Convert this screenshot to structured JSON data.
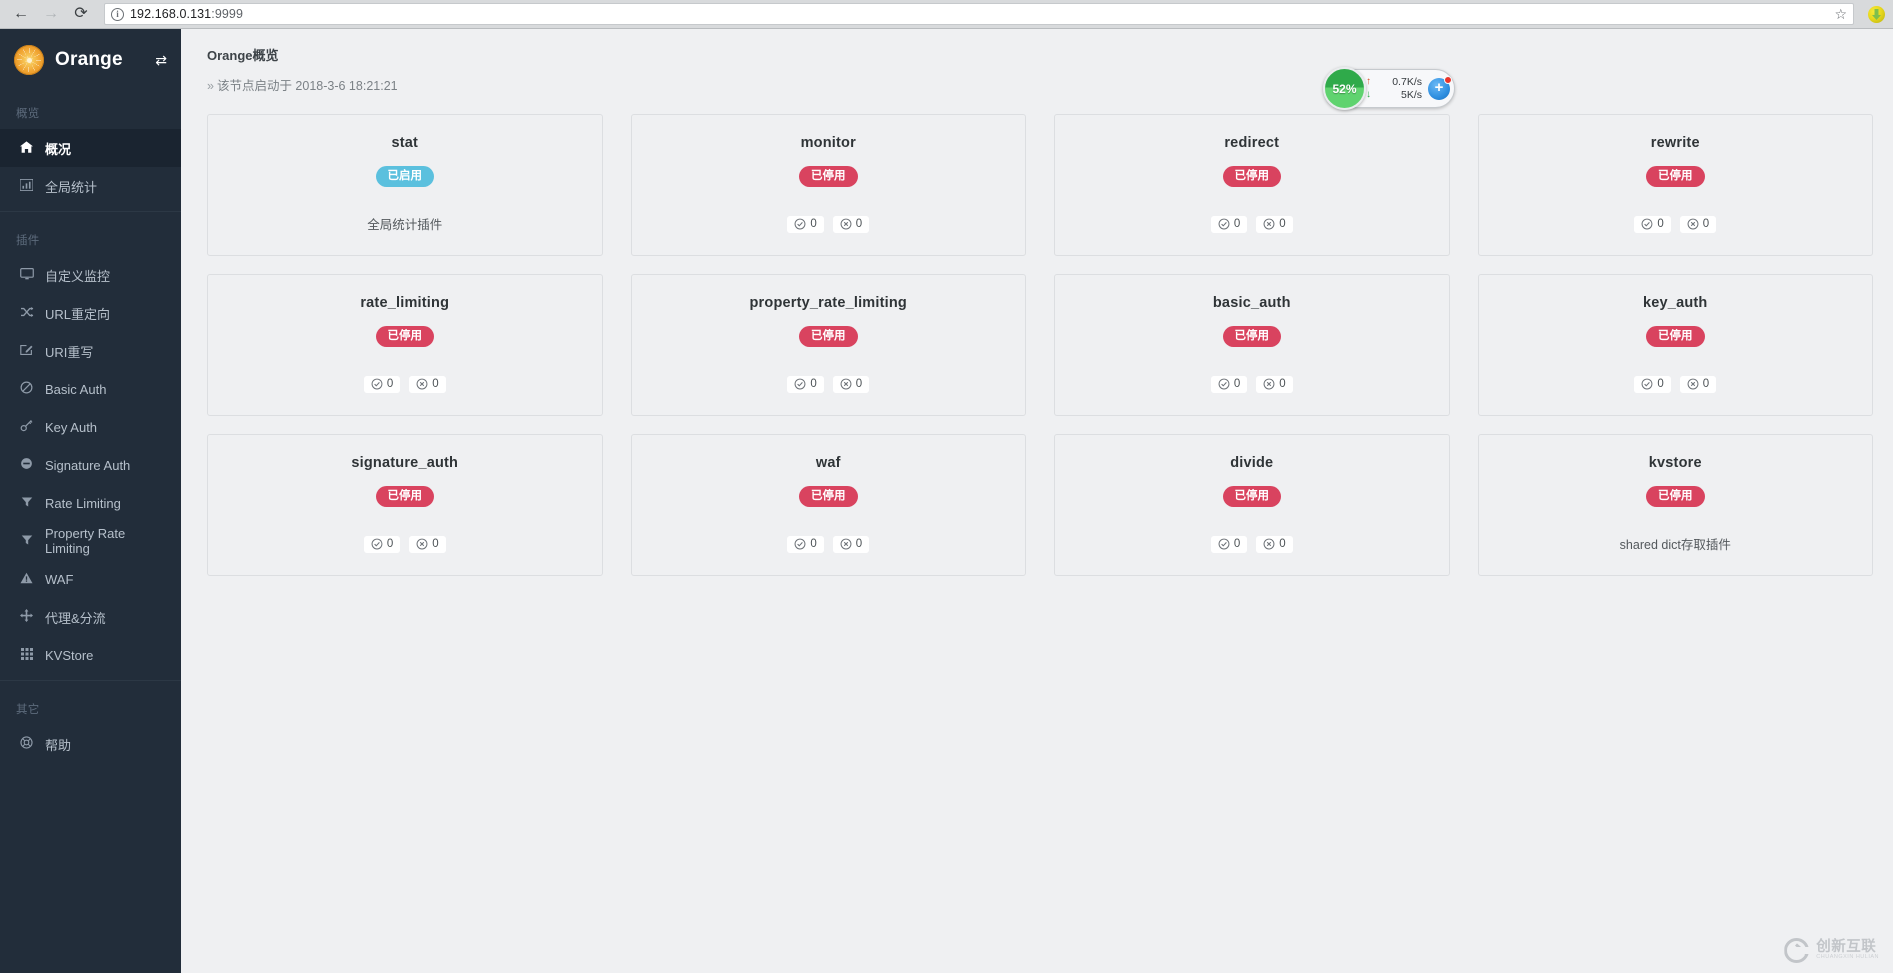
{
  "browser": {
    "back_icon": "←",
    "forward_icon": "→",
    "reload_icon": "⟳",
    "info_icon": "i",
    "url_host": "192.168.0.131",
    "url_port": ":9999",
    "star_icon": "☆",
    "extension_icon": "extension-icon"
  },
  "sidebar": {
    "brand": "Orange",
    "logo_icon": "orange-logo",
    "toggle_icon": "⇄",
    "sections": [
      {
        "label": "概览",
        "items": [
          {
            "label": "概况",
            "icon": "🏠",
            "active": true
          },
          {
            "label": "全局统计",
            "icon": "📊",
            "active": false
          }
        ]
      },
      {
        "label": "插件",
        "items": [
          {
            "label": "自定义监控",
            "icon": "🖥",
            "active": false
          },
          {
            "label": "URL重定向",
            "icon": "⤫",
            "active": false
          },
          {
            "label": "URI重写",
            "icon": "✎",
            "active": false
          },
          {
            "label": "Basic Auth",
            "icon": "⊘",
            "active": false
          },
          {
            "label": "Key Auth",
            "icon": "🔑",
            "active": false
          },
          {
            "label": "Signature Auth",
            "icon": "⊖",
            "active": false
          },
          {
            "label": "Rate Limiting",
            "icon": "▼",
            "active": false
          },
          {
            "label": "Property Rate Limiting",
            "icon": "▼",
            "active": false
          },
          {
            "label": "WAF",
            "icon": "⚠",
            "active": false
          },
          {
            "label": "代理&分流",
            "icon": "✥",
            "active": false
          },
          {
            "label": "KVStore",
            "icon": "▦",
            "active": false
          }
        ]
      },
      {
        "label": "其它",
        "items": [
          {
            "label": "帮助",
            "icon": "☉",
            "active": false
          }
        ]
      }
    ]
  },
  "page": {
    "title": "Orange概览",
    "subtitle_chevron": "»",
    "subtitle": "该节点启动于 2018-3-6 18:21:21"
  },
  "cards": [
    {
      "name": "stat",
      "status": "已启用",
      "status_kind": "on",
      "desc": "全局统计插件",
      "ok": null,
      "err": null
    },
    {
      "name": "monitor",
      "status": "已停用",
      "status_kind": "off",
      "desc": null,
      "ok": "0",
      "err": "0"
    },
    {
      "name": "redirect",
      "status": "已停用",
      "status_kind": "off",
      "desc": null,
      "ok": "0",
      "err": "0"
    },
    {
      "name": "rewrite",
      "status": "已停用",
      "status_kind": "off",
      "desc": null,
      "ok": "0",
      "err": "0"
    },
    {
      "name": "rate_limiting",
      "status": "已停用",
      "status_kind": "off",
      "desc": null,
      "ok": "0",
      "err": "0"
    },
    {
      "name": "property_rate_limiting",
      "status": "已停用",
      "status_kind": "off",
      "desc": null,
      "ok": "0",
      "err": "0"
    },
    {
      "name": "basic_auth",
      "status": "已停用",
      "status_kind": "off",
      "desc": null,
      "ok": "0",
      "err": "0"
    },
    {
      "name": "key_auth",
      "status": "已停用",
      "status_kind": "off",
      "desc": null,
      "ok": "0",
      "err": "0"
    },
    {
      "name": "signature_auth",
      "status": "已停用",
      "status_kind": "off",
      "desc": null,
      "ok": "0",
      "err": "0"
    },
    {
      "name": "waf",
      "status": "已停用",
      "status_kind": "off",
      "desc": null,
      "ok": "0",
      "err": "0"
    },
    {
      "name": "divide",
      "status": "已停用",
      "status_kind": "off",
      "desc": null,
      "ok": "0",
      "err": "0"
    },
    {
      "name": "kvstore",
      "status": "已停用",
      "status_kind": "off",
      "desc": "shared dict存取插件",
      "ok": null,
      "err": null
    }
  ],
  "net_widget": {
    "cpu_percent": "52%",
    "upload_arrow": "↑",
    "upload_rate": "0.7K/s",
    "download_arrow": "↓",
    "download_rate": "5K/s",
    "add_icon": "+",
    "badge_dot": "notification-dot"
  },
  "watermark": {
    "cn": "创新互联",
    "en": "CHUANGXIN HULIAN"
  },
  "colors": {
    "sidebar_bg": "#222d3a",
    "badge_on": "#5bc0de",
    "badge_off": "#d9435f",
    "main_bg": "#eff0f2",
    "gauge_green": "#2faa4a"
  }
}
